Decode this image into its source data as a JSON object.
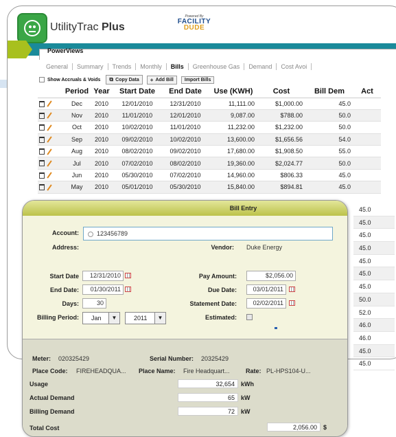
{
  "header": {
    "brand_name_plain": "UtilityTrac ",
    "brand_name_bold": "Plus",
    "powered_by": "Powered By",
    "partner_logo_line1": "FACILITY",
    "partner_logo_line2": "DUDE"
  },
  "main_tab": "PowerViews",
  "subtabs": [
    "General",
    "Summary",
    "Trends",
    "Monthly",
    "Bills",
    "Greenhouse Gas",
    "Demand",
    "Cost Avoi"
  ],
  "toolbar": {
    "show_accruals_label": "Show Accruals & Voids",
    "copy_data_label": "Copy Data",
    "add_bill_label": "Add Bill",
    "import_bills_label": "Import Bills"
  },
  "table": {
    "headers": [
      "",
      "Period",
      "Year",
      "Start Date",
      "End Date",
      "Use (KWH)",
      "Cost",
      "Bill Dem",
      "Act"
    ],
    "rows": [
      {
        "period": "Dec",
        "year": "2010",
        "start": "12/01/2010",
        "end": "12/31/2010",
        "use": "11,111.00",
        "cost": "$1,000.00",
        "bill_dem": "45.0"
      },
      {
        "period": "Nov",
        "year": "2010",
        "start": "11/01/2010",
        "end": "12/01/2010",
        "use": "9,087.00",
        "cost": "$788.00",
        "bill_dem": "50.0"
      },
      {
        "period": "Oct",
        "year": "2010",
        "start": "10/02/2010",
        "end": "11/01/2010",
        "use": "11,232.00",
        "cost": "$1,232.00",
        "bill_dem": "50.0"
      },
      {
        "period": "Sep",
        "year": "2010",
        "start": "09/02/2010",
        "end": "10/02/2010",
        "use": "13,600.00",
        "cost": "$1,656.56",
        "bill_dem": "54.0"
      },
      {
        "period": "Aug",
        "year": "2010",
        "start": "08/02/2010",
        "end": "09/02/2010",
        "use": "17,680.00",
        "cost": "$1,908.50",
        "bill_dem": "55.0"
      },
      {
        "period": "Jul",
        "year": "2010",
        "start": "07/02/2010",
        "end": "08/02/2010",
        "use": "19,360.00",
        "cost": "$2,024.77",
        "bill_dem": "50.0"
      },
      {
        "period": "Jun",
        "year": "2010",
        "start": "05/30/2010",
        "end": "07/02/2010",
        "use": "14,960.00",
        "cost": "$806.33",
        "bill_dem": "45.0"
      },
      {
        "period": "May",
        "year": "2010",
        "start": "05/01/2010",
        "end": "05/30/2010",
        "use": "15,840.00",
        "cost": "$894.81",
        "bill_dem": "45.0"
      }
    ],
    "hidden_bill_dem": [
      "45.0",
      "45.0",
      "45.0",
      "45.0",
      "45.0",
      "45.0",
      "45.0",
      "50.0",
      "52.0",
      "46.0",
      "46.0",
      "45.0",
      "45.0"
    ]
  },
  "dialog": {
    "title": "Bill Entry",
    "account_label": "Account:",
    "account_value": "123456789",
    "address_label": "Address:",
    "vendor_label": "Vendor:",
    "vendor_value": "Duke Energy",
    "start_date_label": "Start Date",
    "start_date_value": "12/31/2010",
    "end_date_label": "End Date:",
    "end_date_value": "01/30/2011",
    "days_label": "Days:",
    "days_value": "30",
    "billing_period_label": "Billing Period:",
    "billing_month": "Jan",
    "billing_year": "2011",
    "pay_amount_label": "Pay Amount:",
    "pay_amount_value": "$2,056.00",
    "due_date_label": "Due Date:",
    "due_date_value": "03/01/2011",
    "statement_date_label": "Statement Date:",
    "statement_date_value": "02/02/2011",
    "estimated_label": "Estimated:",
    "meter_label": "Meter:",
    "meter_value": "020325429",
    "serial_label": "Serial Number:",
    "serial_value": "20325429",
    "place_code_label": "Place Code:",
    "place_code_value": "FIREHEADQUA...",
    "place_name_label": "Place Name:",
    "place_name_value": "Fire Headquart...",
    "rate_label": "Rate:",
    "rate_value": "PL-HPS104-U...",
    "usage_label": "Usage",
    "usage_value": "32,654",
    "usage_unit": "kWh",
    "actual_demand_label": "Actual Demand",
    "actual_demand_value": "65",
    "actual_demand_unit": "kW",
    "billing_demand_label": "Billing Demand",
    "billing_demand_value": "72",
    "billing_demand_unit": "kW",
    "total_cost_label": "Total Cost",
    "total_cost_value": "2,056.00",
    "total_cost_unit": "$"
  },
  "colors": {
    "teal_bar": "#1a8a9a",
    "brand_green": "#3aa646",
    "dialog_title": "#c8cc60",
    "dialog_body": "#f4f4de",
    "dialog_lower": "#dcdccb"
  }
}
